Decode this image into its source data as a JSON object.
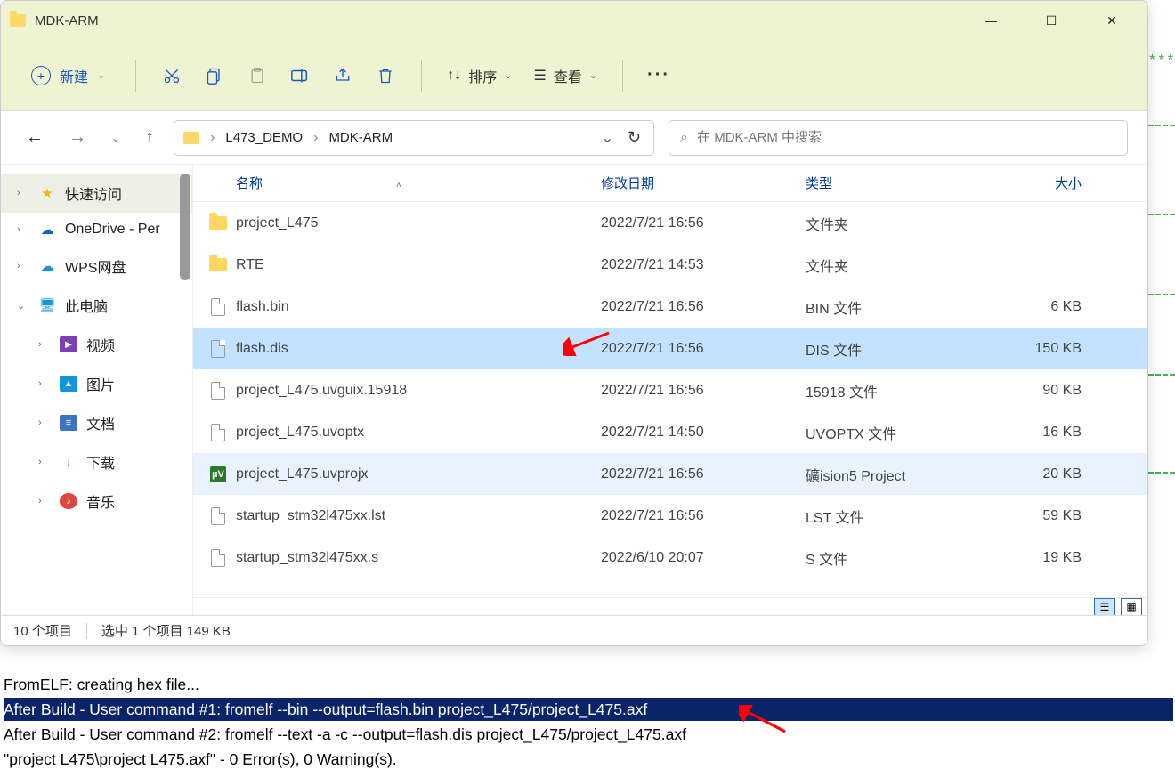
{
  "window": {
    "title": "MDK-ARM"
  },
  "toolbar": {
    "new_label": "新建",
    "sort_label": "排序",
    "view_label": "查看"
  },
  "breadcrumb": {
    "seg1": "L473_DEMO",
    "seg2": "MDK-ARM"
  },
  "search": {
    "placeholder": "在 MDK-ARM 中搜索"
  },
  "sidebar": {
    "quick": "快速访问",
    "onedrive": "OneDrive - Per",
    "wps": "WPS网盘",
    "thispc": "此电脑",
    "videos": "视频",
    "pictures": "图片",
    "documents": "文档",
    "downloads": "下载",
    "music": "音乐"
  },
  "columns": {
    "name": "名称",
    "date": "修改日期",
    "type": "类型",
    "size": "大小"
  },
  "files": [
    {
      "name": "project_L475",
      "date": "2022/7/21 16:56",
      "type": "文件夹",
      "size": "",
      "icon": "folder"
    },
    {
      "name": "RTE",
      "date": "2022/7/21 14:53",
      "type": "文件夹",
      "size": "",
      "icon": "folder"
    },
    {
      "name": "flash.bin",
      "date": "2022/7/21 16:56",
      "type": "BIN 文件",
      "size": "6 KB",
      "icon": "file"
    },
    {
      "name": "flash.dis",
      "date": "2022/7/21 16:56",
      "type": "DIS 文件",
      "size": "150 KB",
      "icon": "file"
    },
    {
      "name": "project_L475.uvguix.15918",
      "date": "2022/7/21 16:56",
      "type": "15918 文件",
      "size": "90 KB",
      "icon": "file"
    },
    {
      "name": "project_L475.uvoptx",
      "date": "2022/7/21 14:50",
      "type": "UVOPTX 文件",
      "size": "16 KB",
      "icon": "file"
    },
    {
      "name": "project_L475.uvprojx",
      "date": "2022/7/21 16:56",
      "type": "礦ision5 Project",
      "size": "20 KB",
      "icon": "uv"
    },
    {
      "name": "startup_stm32l475xx.lst",
      "date": "2022/7/21 16:56",
      "type": "LST 文件",
      "size": "59 KB",
      "icon": "file"
    },
    {
      "name": "startup_stm32l475xx.s",
      "date": "2022/6/10 20:07",
      "type": "S 文件",
      "size": "19 KB",
      "icon": "file"
    }
  ],
  "status": {
    "count": "10 个项目",
    "sel": "选中 1 个项目  149 KB"
  },
  "console": {
    "l1": "FromELF: creating hex file...",
    "l2": "After Build - User command #1: fromelf --bin --output=flash.bin project_L475/project_L475.axf",
    "l3": "After Build - User command #2: fromelf --text -a -c --output=flash.dis project_L475/project_L475.axf",
    "l4": "\"project L475\\project L475.axf\" - 0 Error(s), 0 Warning(s)."
  }
}
